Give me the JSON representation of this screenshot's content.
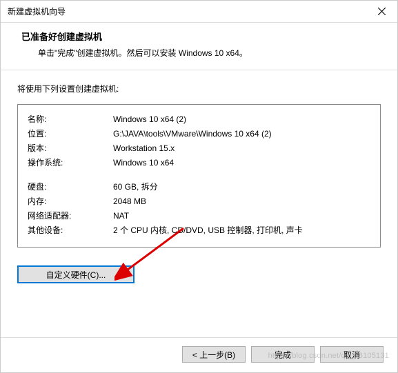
{
  "titlebar": {
    "title": "新建虚拟机向导"
  },
  "header": {
    "title": "已准备好创建虚拟机",
    "subtitle": "单击\"完成\"创建虚拟机。然后可以安装 Windows 10 x64。"
  },
  "instruction": "将使用下列设置创建虚拟机:",
  "settings": {
    "group1": [
      {
        "label": "名称:",
        "value": "Windows 10 x64 (2)"
      },
      {
        "label": "位置:",
        "value": "G:\\JAVA\\tools\\VMware\\Windows 10 x64 (2)"
      },
      {
        "label": "版本:",
        "value": "Workstation 15.x"
      },
      {
        "label": "操作系统:",
        "value": "Windows 10 x64"
      }
    ],
    "group2": [
      {
        "label": "硬盘:",
        "value": "60 GB, 拆分"
      },
      {
        "label": "内存:",
        "value": "2048 MB"
      },
      {
        "label": "网络适配器:",
        "value": "NAT"
      },
      {
        "label": "其他设备:",
        "value": "2 个 CPU 内核, CD/DVD, USB 控制器, 打印机, 声卡"
      }
    ]
  },
  "buttons": {
    "customize": "自定义硬件(C)...",
    "back": "< 上一步(B)",
    "finish": "完成",
    "cancel": "取消"
  },
  "watermark": "https://blog.csdn.net/qq_38105131"
}
